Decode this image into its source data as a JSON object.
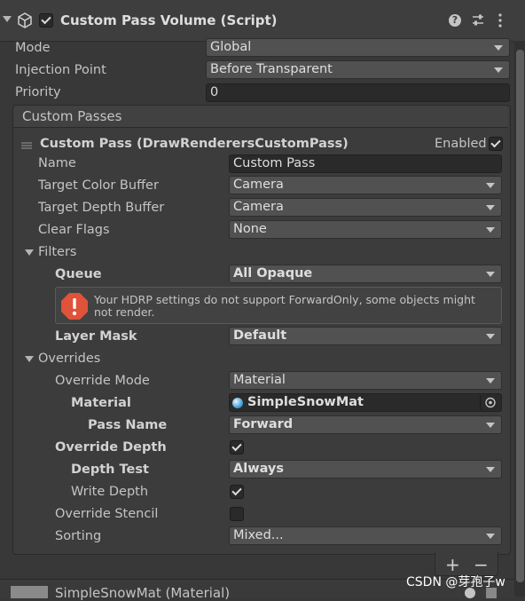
{
  "component": {
    "title": "Custom Pass Volume (Script)",
    "enabled": true
  },
  "fields": {
    "mode_label": "Mode",
    "mode_value": "Global",
    "injection_label": "Injection Point",
    "injection_value": "Before Transparent",
    "priority_label": "Priority",
    "priority_value": "0"
  },
  "custom_passes": {
    "header": "Custom Passes",
    "pass_title": "Custom Pass (DrawRenderersCustomPass)",
    "enabled_label": "Enabled",
    "enabled": true,
    "name_label": "Name",
    "name_value": "Custom Pass",
    "color_label": "Target Color Buffer",
    "color_value": "Camera",
    "depth_label": "Target Depth Buffer",
    "depth_value": "Camera",
    "clear_label": "Clear Flags",
    "clear_value": "None",
    "filters_label": "Filters",
    "queue_label": "Queue",
    "queue_value": "All Opaque",
    "warning": "Your HDRP settings do not support ForwardOnly, some objects might not render.",
    "layer_label": "Layer Mask",
    "layer_value": "Default",
    "overrides_label": "Overrides",
    "override_mode_label": "Override Mode",
    "override_mode_value": "Material",
    "material_label": "Material",
    "material_value": "SimpleSnowMat",
    "pass_name_label": "Pass Name",
    "pass_name_value": "Forward",
    "override_depth_label": "Override Depth",
    "override_depth": true,
    "depth_test_label": "Depth Test",
    "depth_test_value": "Always",
    "write_depth_label": "Write Depth",
    "write_depth": true,
    "override_stencil_label": "Override Stencil",
    "override_stencil": false,
    "sorting_label": "Sorting",
    "sorting_value": "Mixed..."
  },
  "list_controls": {
    "add": "+",
    "remove": "−"
  },
  "footer": {
    "material_name": "SimpleSnowMat (Material)",
    "watermark": "CSDN @芽孢子w"
  },
  "colors": {
    "warning": "#e0523a",
    "panel": "#3c3c3c",
    "background": "#383838"
  }
}
